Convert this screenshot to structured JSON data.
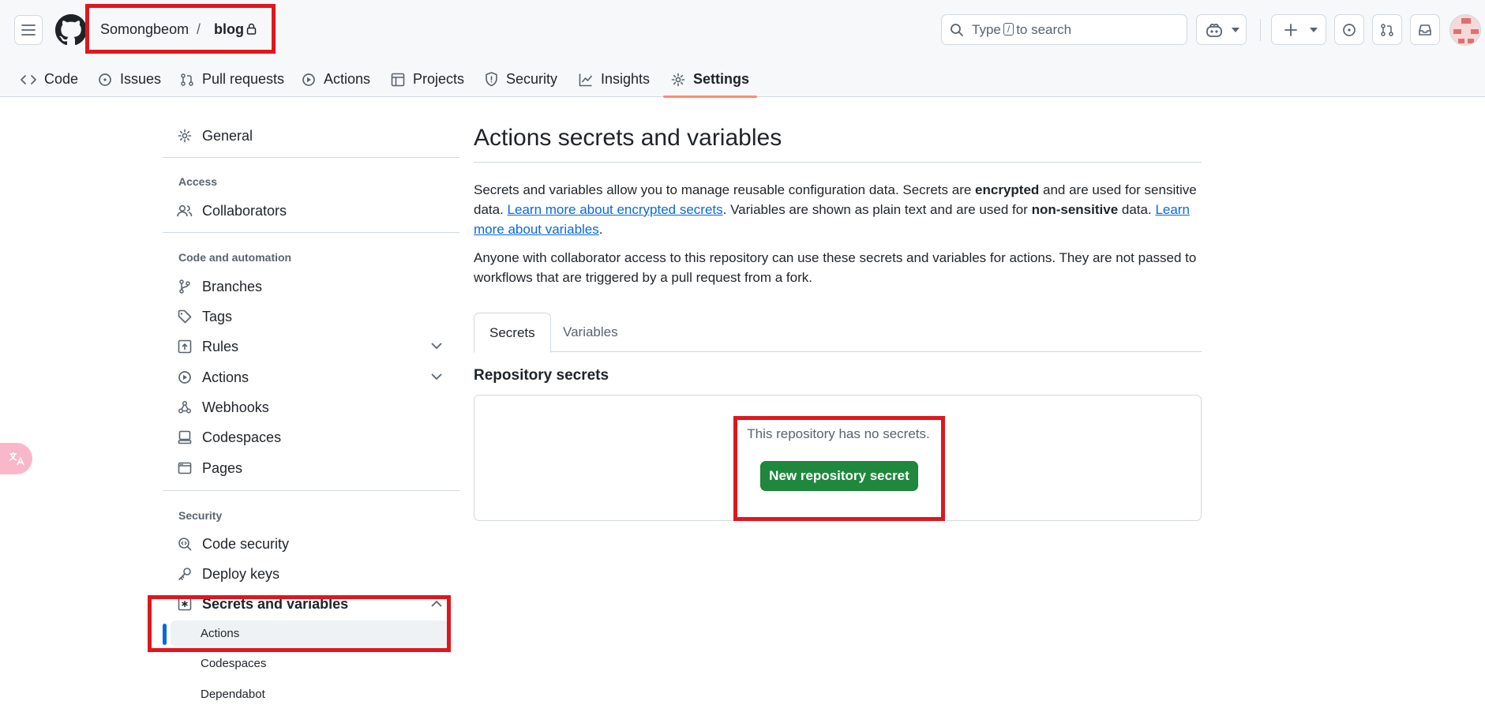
{
  "header": {
    "owner": "Somongbeom",
    "separator": "/",
    "repo": "blog",
    "search_prefix": "Type",
    "search_key": "/",
    "search_suffix": "to search"
  },
  "tabs": [
    {
      "label": "Code",
      "icon": "code-icon"
    },
    {
      "label": "Issues",
      "icon": "issue-icon"
    },
    {
      "label": "Pull requests",
      "icon": "pull-request-icon"
    },
    {
      "label": "Actions",
      "icon": "play-icon"
    },
    {
      "label": "Projects",
      "icon": "table-icon"
    },
    {
      "label": "Security",
      "icon": "shield-icon"
    },
    {
      "label": "Insights",
      "icon": "graph-icon"
    },
    {
      "label": "Settings",
      "icon": "gear-icon",
      "active": true
    }
  ],
  "sidebar": {
    "general": "General",
    "access_heading": "Access",
    "collaborators": "Collaborators",
    "code_heading": "Code and automation",
    "branches": "Branches",
    "tags": "Tags",
    "rules": "Rules",
    "actions": "Actions",
    "webhooks": "Webhooks",
    "codespaces": "Codespaces",
    "pages": "Pages",
    "security_heading": "Security",
    "code_security": "Code security",
    "deploy_keys": "Deploy keys",
    "secrets_and_variables": "Secrets and variables",
    "sub_actions": "Actions",
    "sub_codespaces": "Codespaces",
    "sub_dependabot": "Dependabot"
  },
  "main": {
    "title": "Actions secrets and variables",
    "p1_a": "Secrets and variables allow you to manage reusable configuration data. Secrets are ",
    "p1_b": "encrypted",
    "p1_c": " and are used for sensitive data. ",
    "p1_link1": "Learn more about encrypted secrets",
    "p1_d": ". Variables are shown as plain text and are used for ",
    "p1_e": "non-sensitive",
    "p1_f": " data. ",
    "p1_link2": "Learn more about variables",
    "p1_g": ".",
    "p2": "Anyone with collaborator access to this repository can use these secrets and variables for actions. They are not passed to workflows that are triggered by a pull request from a fork.",
    "tab_secrets": "Secrets",
    "tab_variables": "Variables",
    "repo_secrets_heading": "Repository secrets",
    "empty_text": "This repository has no secrets.",
    "new_secret_button": "New repository secret"
  },
  "colors": {
    "accent": "#0969da",
    "primary_button": "#1f883d",
    "active_tab_underline": "#fd8c73",
    "highlight_box": "#e0161e"
  }
}
